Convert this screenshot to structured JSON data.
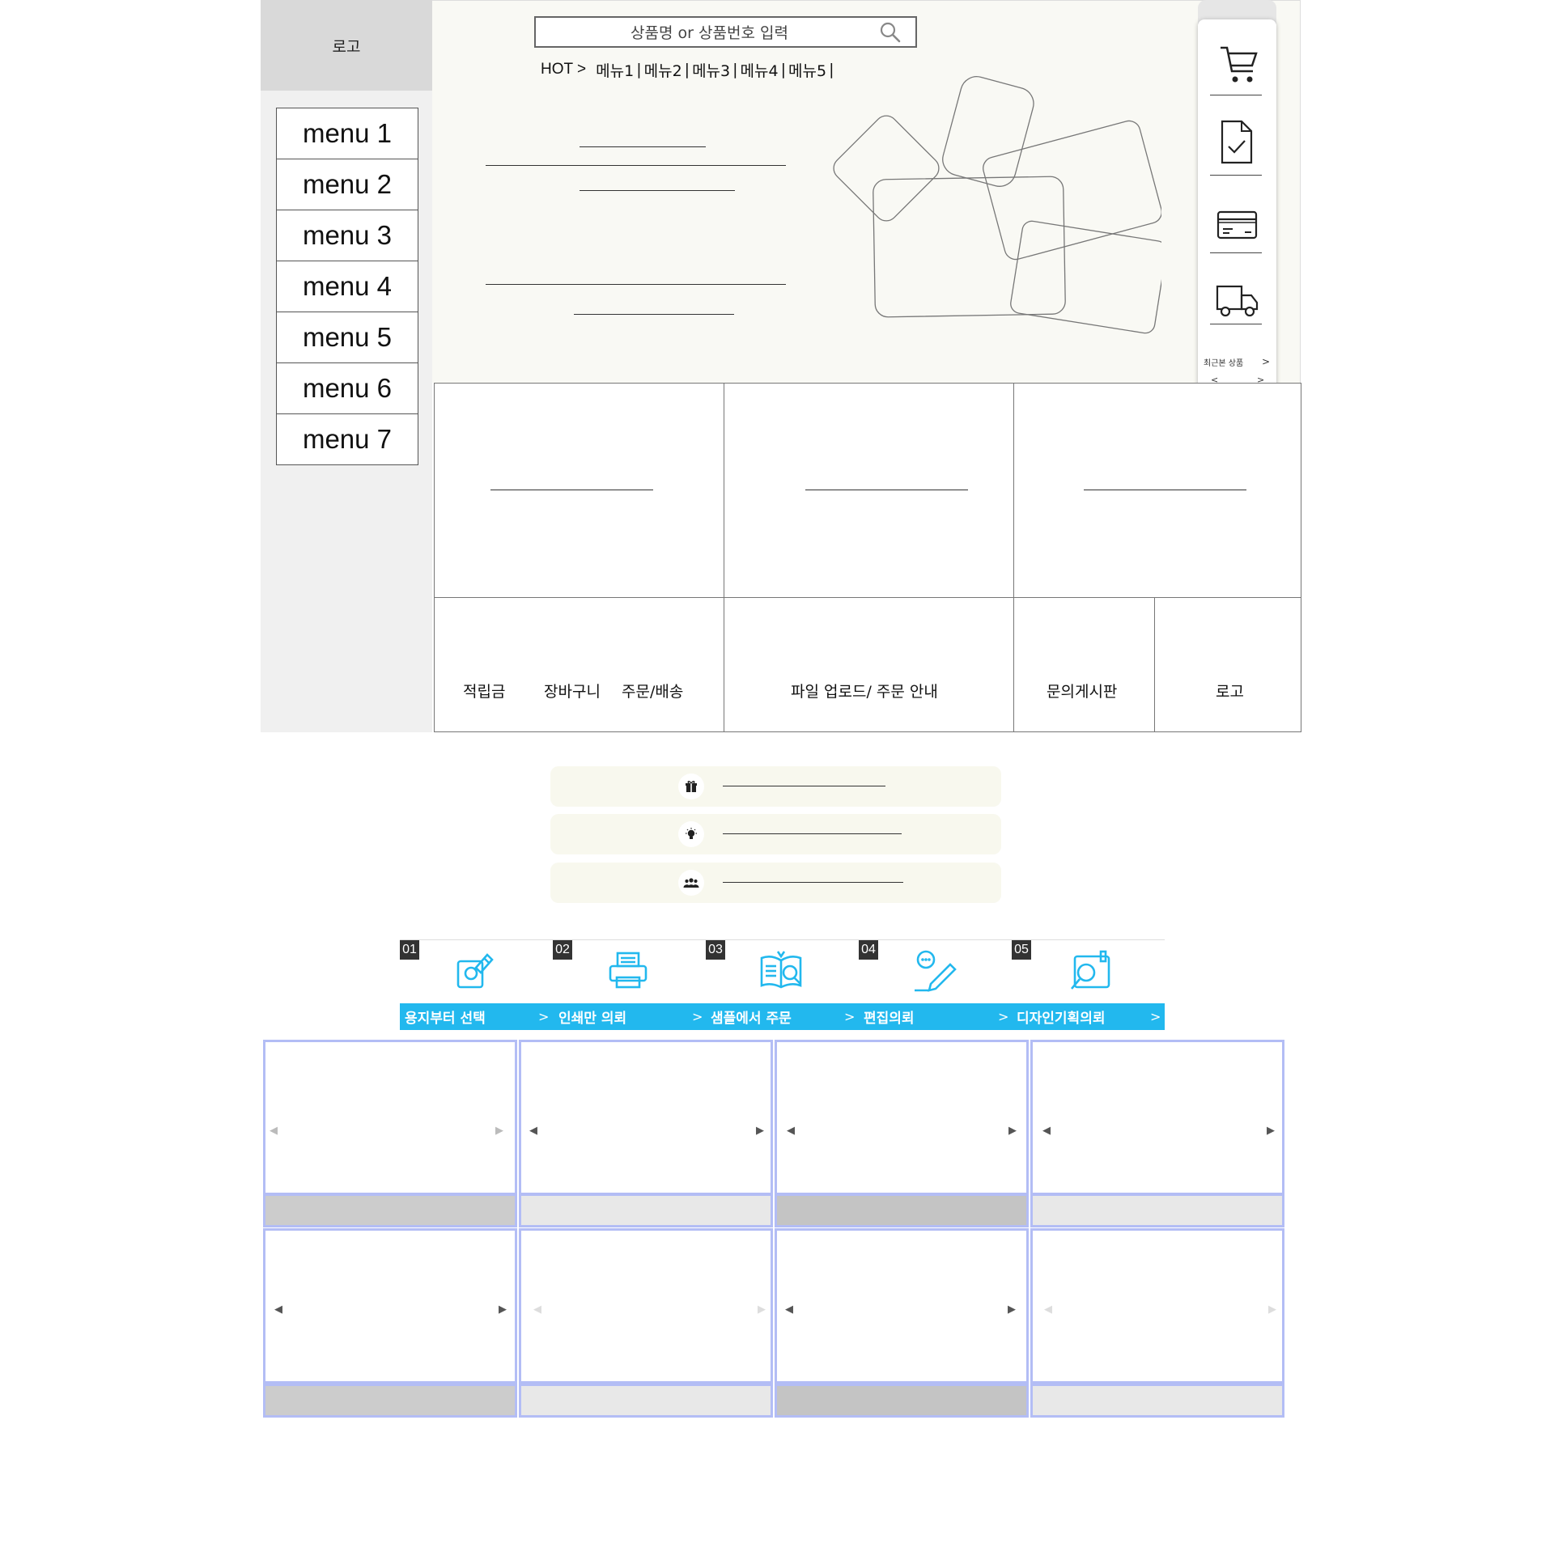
{
  "sidebar": {
    "logo": "로고",
    "menu": [
      "menu 1",
      "menu 2",
      "menu 3",
      "menu 4",
      "menu 5",
      "menu 6",
      "menu 7"
    ]
  },
  "header": {
    "search_placeholder": "상품명 or 상품번호 입력",
    "hot_label": "HOT >",
    "hot_menu": [
      "메뉴1",
      "메뉴2",
      "메뉴3",
      "메뉴4",
      "메뉴5"
    ],
    "separator": "|"
  },
  "quick_panel": {
    "icons": [
      "cart-icon",
      "checked-document-icon",
      "credit-card-icon",
      "delivery-truck-icon"
    ],
    "recent_label": "최근본 상품",
    "more": ">",
    "prev": "<",
    "next": ">"
  },
  "bottom_row": {
    "links": [
      "적립금",
      "장바구니",
      "주문/배송"
    ],
    "file_upload": "파일 업로드/ 주문 안내",
    "board": "문의게시판",
    "logo": "로고"
  },
  "info_pills": {
    "icons": [
      "gift-icon",
      "lightbulb-icon",
      "people-icon"
    ]
  },
  "steps": {
    "numbers": [
      "01",
      "02",
      "03",
      "04",
      "05"
    ],
    "labels": [
      "용지부터 선택",
      "인쇄만 의뢰",
      "샘플에서 주문",
      "편집의뢰",
      "디자인기획의뢰"
    ],
    "arrow": ">",
    "icons": [
      "paper-select-icon",
      "printer-icon",
      "sample-book-icon",
      "edit-pencil-icon",
      "design-search-icon"
    ],
    "accent": "#22b8ee"
  },
  "gallery": {
    "prev_arrow": "◀",
    "next_arrow": "▶",
    "border_color": "#b3bdf5",
    "caption_colors": [
      "#cccccc",
      "#e8e8e8",
      "#c4c4c4",
      "#e8e8e8"
    ]
  }
}
